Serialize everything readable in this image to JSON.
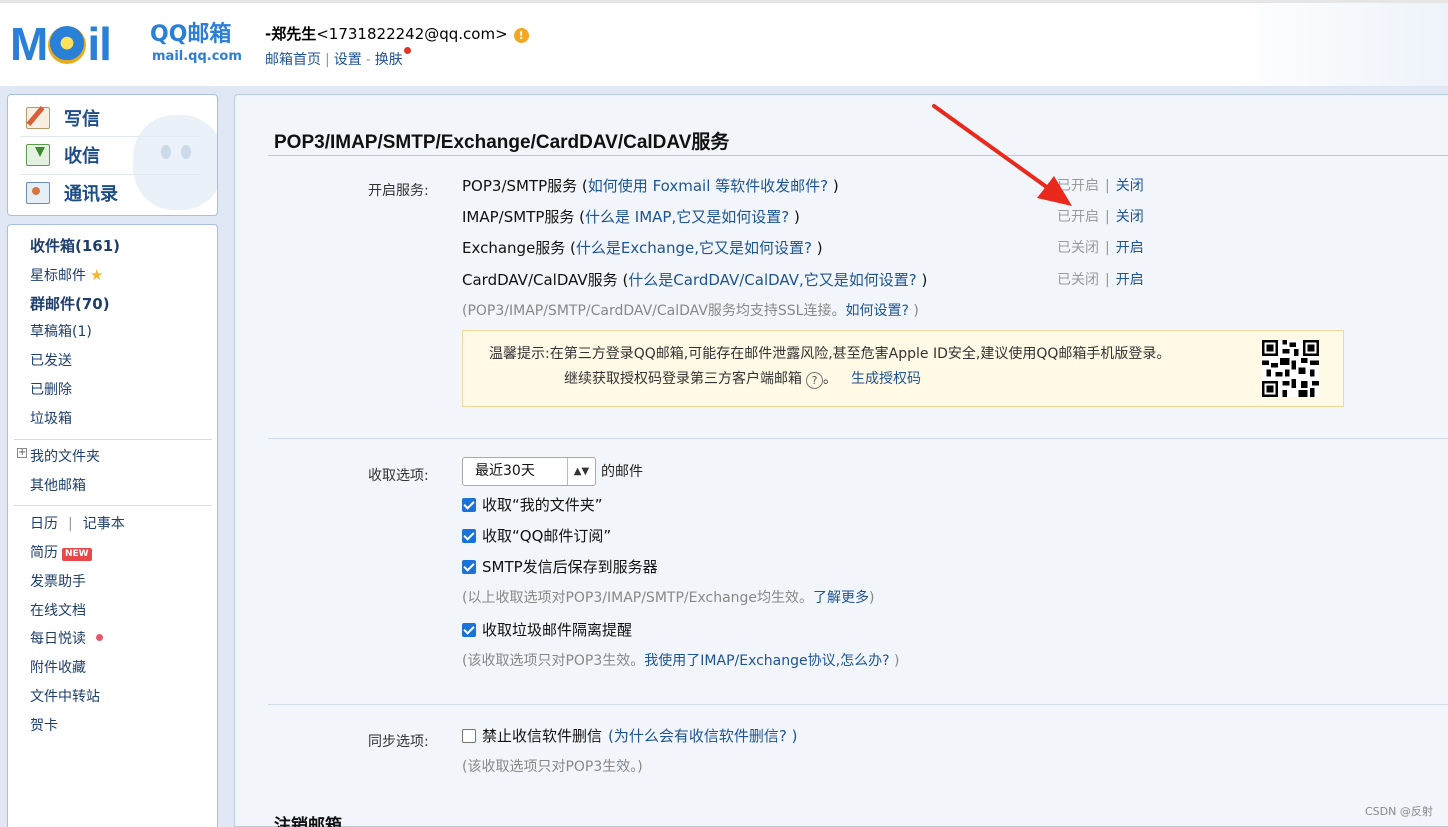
{
  "header": {
    "logo_mail": "M",
    "logo_mail_rest": "il",
    "logo_brand": "QQ邮箱",
    "logo_url": "mail.qq.com",
    "user_name": "-郑先生",
    "user_email": "<1731822242@qq.com>",
    "warn_glyph": "!",
    "links": {
      "home": "邮箱首页",
      "sep1": "|",
      "settings": "设置",
      "sep2": "-",
      "skin": "换肤"
    }
  },
  "sidebar": {
    "compose": "写信",
    "receive": "收信",
    "contacts": "通讯录",
    "inbox": "收件箱(161)",
    "starred": "星标邮件",
    "star_glyph": "★",
    "group": "群邮件(70)",
    "drafts": "草稿箱(1)",
    "sent": "已发送",
    "deleted": "已删除",
    "junk": "垃圾箱",
    "tree_glyph": "+",
    "my_folders": "我的文件夹",
    "other_mail": "其他邮箱",
    "calendar": "日历",
    "bar": "|",
    "notes": "记事本",
    "resume": "简历",
    "new_badge": "NEW",
    "invoice": "发票助手",
    "docs": "在线文档",
    "daily": "每日悦读",
    "attachments": "附件收藏",
    "transfer": "文件中转站",
    "cards": "贺卡"
  },
  "main": {
    "title": "POP3/IMAP/SMTP/Exchange/CardDAV/CalDAV服务",
    "enable_label": "开启服务:",
    "services": [
      {
        "name": "POP3/SMTP服务 (",
        "link": "如何使用 Foxmail 等软件收发邮件?",
        "close": " )",
        "status": "已开启",
        "sep": "|",
        "action": "关闭"
      },
      {
        "name": "IMAP/SMTP服务 (",
        "link": "什么是 IMAP,它又是如何设置?",
        "close": " )",
        "status": "已开启",
        "sep": "|",
        "action": "关闭"
      },
      {
        "name": "Exchange服务 (",
        "link": "什么是Exchange,它又是如何设置?",
        "close": " )",
        "status": "已关闭",
        "sep": "|",
        "action": "开启"
      },
      {
        "name": "CardDAV/CalDAV服务 (",
        "link": "什么是CardDAV/CalDAV,它又是如何设置?",
        "close": " )",
        "status": "已关闭",
        "sep": "|",
        "action": "开启"
      }
    ],
    "ssl_note_pre": "(POP3/IMAP/SMTP/CardDAV/CalDAV服务均支持SSL连接。",
    "ssl_note_link": "如何设置?",
    "ssl_note_post": " )",
    "tip_line1": "温馨提示:在第三方登录QQ邮箱,可能存在邮件泄露风险,甚至危害Apple ID安全,建议使用QQ邮箱手机版登录。",
    "tip_line2": "继续获取授权码登录第三方客户端邮箱",
    "tip_help": "?",
    "tip_post": "。",
    "tip_link": "生成授权码",
    "fetch_label": "收取选项:",
    "fetch_select": "最近30天",
    "select_arrows": "▲▼",
    "fetch_after": "的邮件",
    "cb_my_folders": "收取“我的文件夹”",
    "cb_subscriptions": "收取“QQ邮件订阅”",
    "cb_smtp_save": "SMTP发信后保存到服务器",
    "fetch_note_pre": "(以上收取选项对POP3/IMAP/SMTP/Exchange均生效。",
    "fetch_note_link": "了解更多",
    "fetch_note_post": ")",
    "cb_junk": "收取垃圾邮件隔离提醒",
    "pop3_note_pre": "(该收取选项只对POP3生效。",
    "pop3_note_link": "我使用了IMAP/Exchange协议,怎么办?",
    "pop3_note_post": " )",
    "sync_label": "同步选项:",
    "cb_no_delete": "禁止收信软件删信",
    "cb_no_delete_link": "(为什么会有收信软件删信? )",
    "sync_note": "(该收取选项只对POP3生效。)",
    "logout_title": "注销邮箱"
  },
  "watermark": "CSDN @反射",
  "colors": {
    "accent": "#1e5494",
    "brand": "#2a7fd6",
    "annotation_arrow": "#e8291c",
    "checkbox": "#1a73d9"
  }
}
